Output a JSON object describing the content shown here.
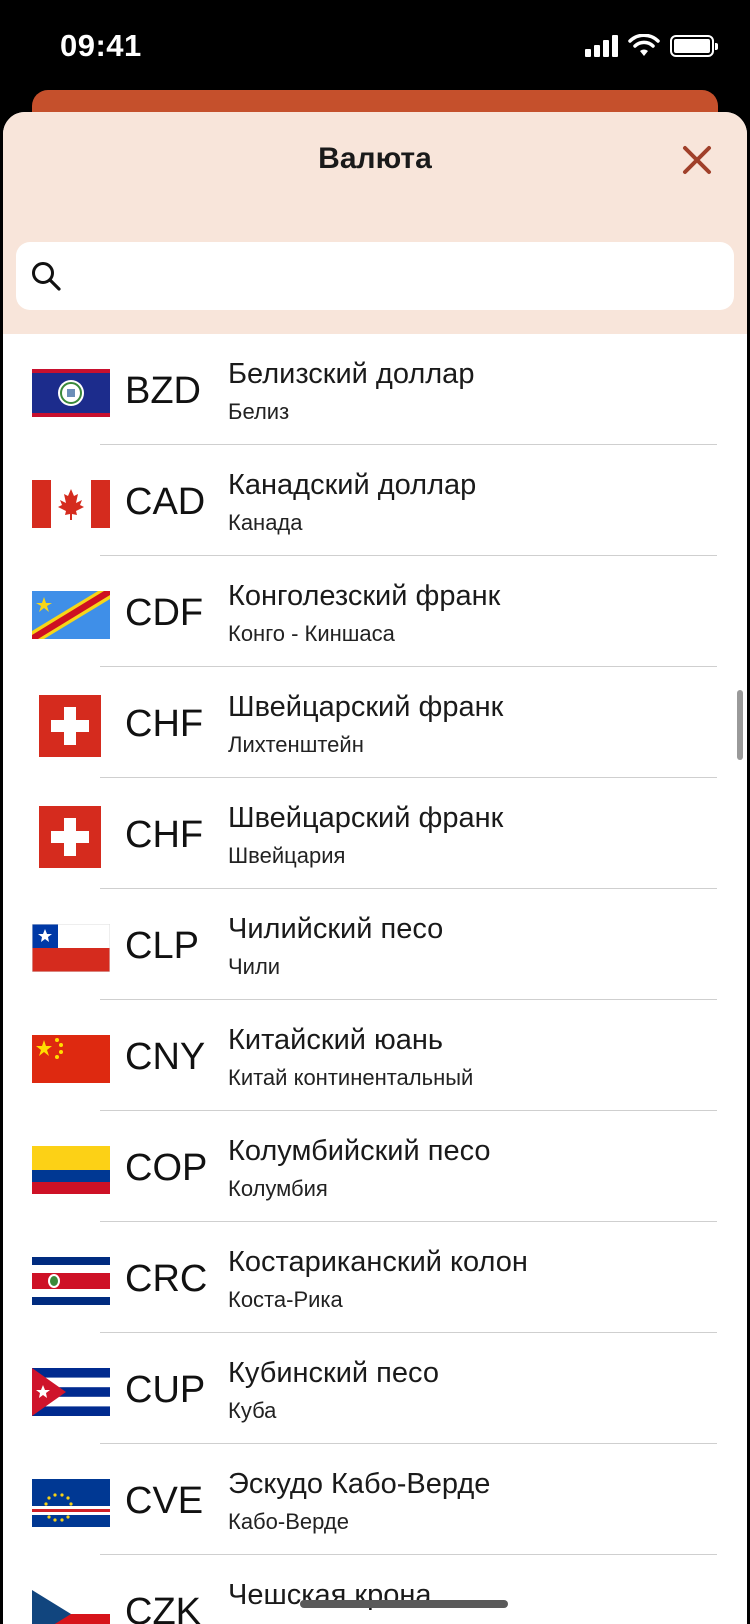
{
  "status_bar": {
    "time": "09:41"
  },
  "sheet": {
    "title": "Валюта",
    "close_icon": "close-icon",
    "search": {
      "placeholder": "",
      "icon": "search-icon"
    }
  },
  "colors": {
    "header_bg": "#f8e5da",
    "accent": "#c5502c",
    "close": "#a0402a"
  },
  "currencies": [
    {
      "code": "BZD",
      "name": "Белизский доллар",
      "country": "Белиз",
      "flag": "belize-flag"
    },
    {
      "code": "CAD",
      "name": "Канадский доллар",
      "country": "Канада",
      "flag": "canada-flag"
    },
    {
      "code": "CDF",
      "name": "Конголезский франк",
      "country": "Конго - Киншаса",
      "flag": "dr-congo-flag"
    },
    {
      "code": "CHF",
      "name": "Швейцарский франк",
      "country": "Лихтенштейн",
      "flag": "swiss-flag"
    },
    {
      "code": "CHF",
      "name": "Швейцарский франк",
      "country": "Швейцария",
      "flag": "swiss-flag"
    },
    {
      "code": "CLP",
      "name": "Чилийский песо",
      "country": "Чили",
      "flag": "chile-flag"
    },
    {
      "code": "CNY",
      "name": "Китайский юань",
      "country": "Китай континентальный",
      "flag": "china-flag"
    },
    {
      "code": "COP",
      "name": "Колумбийский песо",
      "country": "Колумбия",
      "flag": "colombia-flag"
    },
    {
      "code": "CRC",
      "name": "Костариканский колон",
      "country": "Коста-Рика",
      "flag": "costa-rica-flag"
    },
    {
      "code": "CUP",
      "name": "Кубинский песо",
      "country": "Куба",
      "flag": "cuba-flag"
    },
    {
      "code": "CVE",
      "name": "Эскудо Кабо-Верде",
      "country": "Кабо-Верде",
      "flag": "cape-verde-flag"
    },
    {
      "code": "CZK",
      "name": "Чешская крона",
      "country": "",
      "flag": "czech-flag"
    }
  ]
}
